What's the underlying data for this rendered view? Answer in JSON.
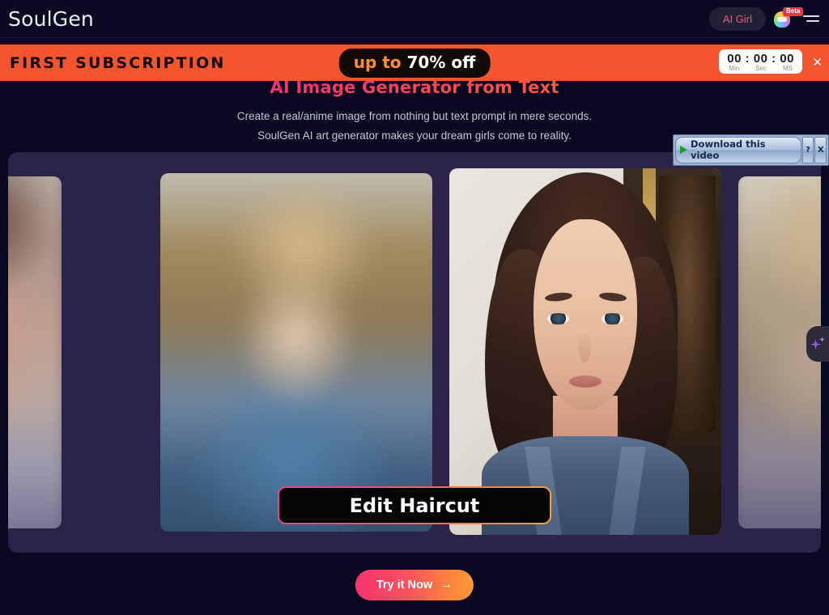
{
  "navbar": {
    "brand": "SoulGen",
    "ai_girl_label": "AI Girl",
    "ghost_icon": "ghost-icon",
    "beta_badge": "Beta",
    "menu_icon": "hamburger-menu-icon"
  },
  "promo": {
    "title": "FIRST SUBSCRIPTION",
    "offer_prefix": "up to ",
    "offer_highlight": "70% off",
    "timer": {
      "digits": "00 : 00 : 00",
      "label_min": "Min",
      "label_sec": "Sec",
      "label_ms": "MS"
    },
    "close_icon": "✕"
  },
  "hero": {
    "title": "AI Image Generator from Text",
    "subtitle_line1": "Create a real/anime image from nothing but text prompt in mere seconds.",
    "subtitle_line2": "SoulGen AI art generator makes your dream girls come to reality."
  },
  "download_widget": {
    "play_icon": "play-icon",
    "label": "Download this video",
    "help_label": "?",
    "close_label": "X"
  },
  "carousel": {
    "panels": [
      {
        "name": "panel-left-far",
        "focused": false
      },
      {
        "name": "panel-left",
        "focused": false
      },
      {
        "name": "panel-center",
        "focused": true
      },
      {
        "name": "panel-right",
        "focused": false
      }
    ],
    "overlay_button": "Edit Haircut"
  },
  "fab": {
    "icon": "sparkle-icon"
  },
  "cta": {
    "label": "Try it Now",
    "arrow": "→"
  },
  "colors": {
    "page_bg": "#0a0820",
    "navbar_bg": "#0b0a22",
    "promo_bg": "#f4552f",
    "carousel_bg": "#2b2348",
    "accent_pink": "#f6336e",
    "accent_orange": "#fd9a33",
    "beta_red": "#f0324b"
  }
}
